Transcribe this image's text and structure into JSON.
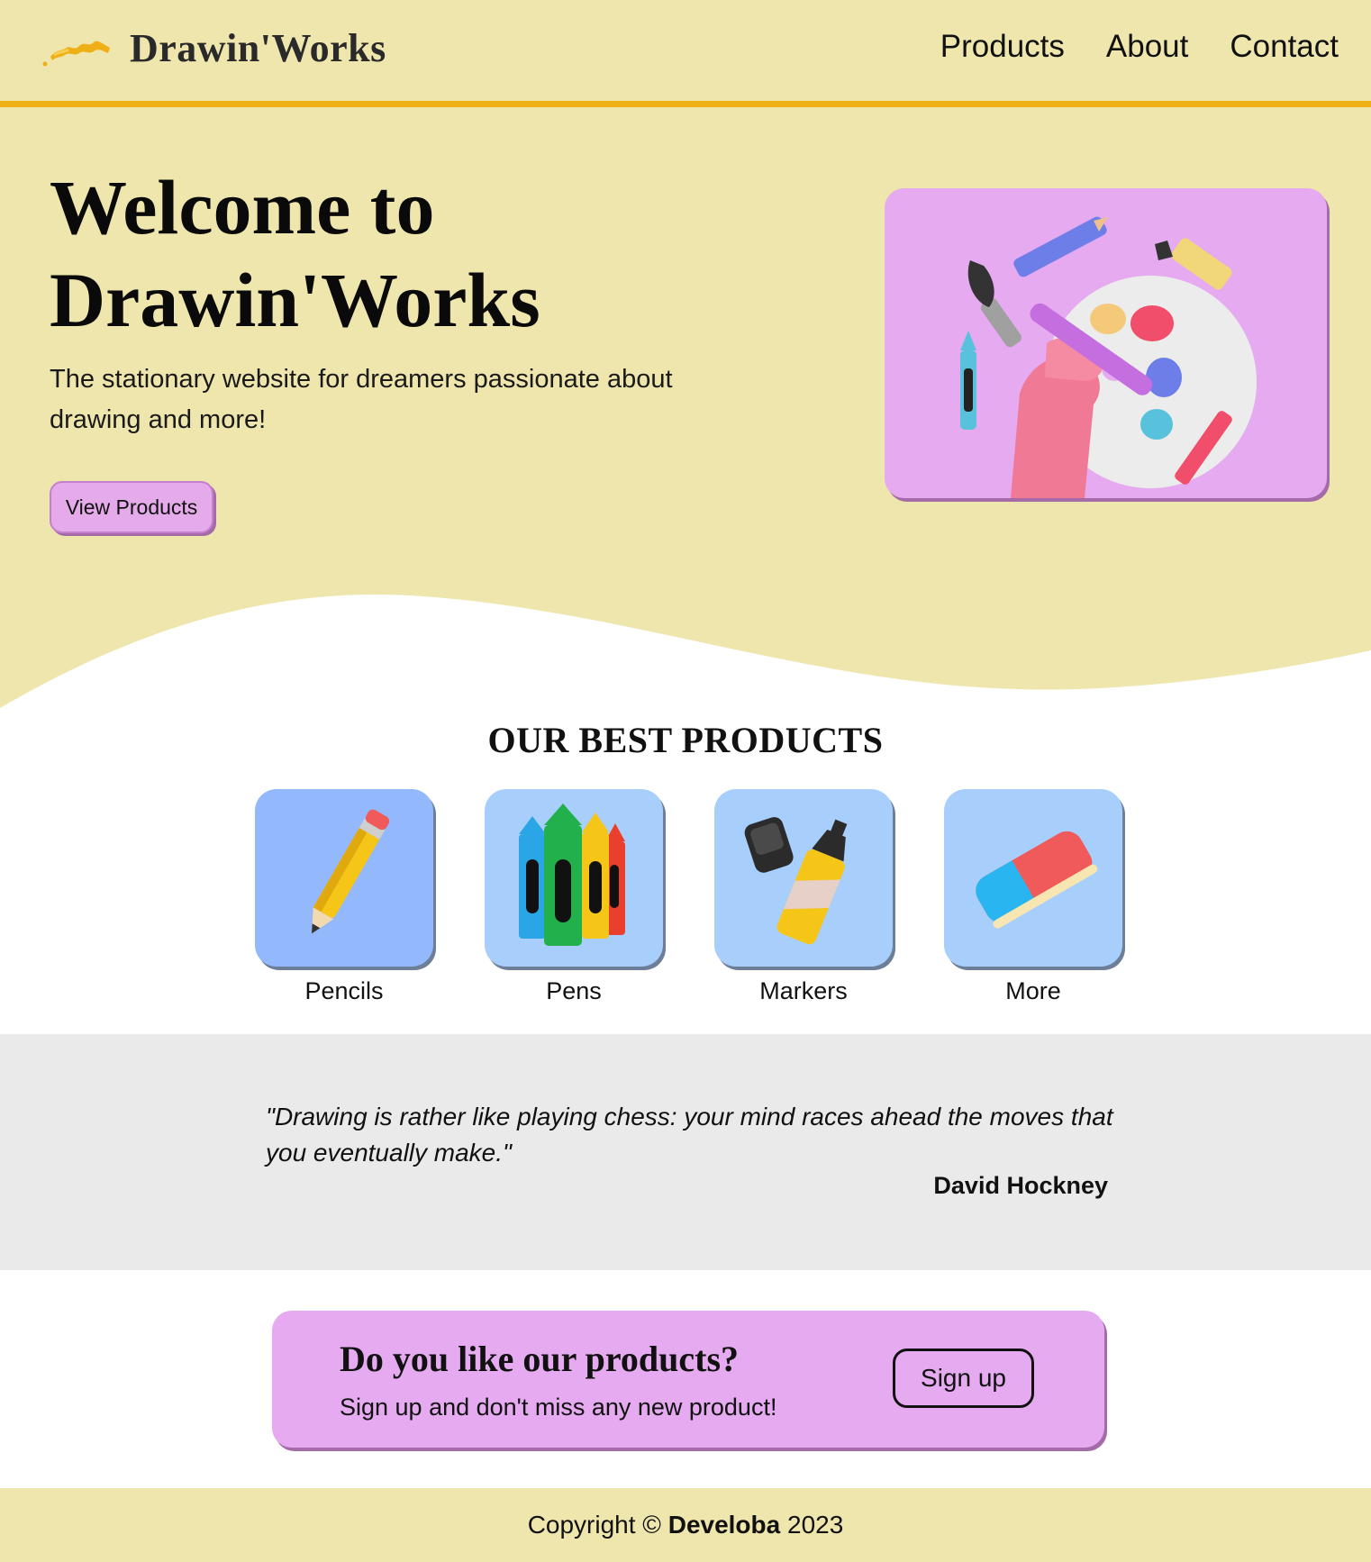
{
  "brand": {
    "name": "Drawin'Works",
    "logo_icon": "paint-stroke-icon",
    "accent": "#efaf16"
  },
  "nav": {
    "items": [
      "Products",
      "About",
      "Contact"
    ]
  },
  "hero": {
    "title_line1": "Welcome to",
    "title_line2": "Drawin'Works",
    "subtitle": "The stationary website for dreamers passionate about drawing and more!",
    "button_label": "View Products",
    "image_icon": "hand-holding-paintbrush-palette-illustration"
  },
  "products": {
    "title": "OUR BEST PRODUCTS",
    "items": [
      {
        "label": "Pencils",
        "icon": "pencil-icon"
      },
      {
        "label": "Pens",
        "icon": "crayons-icon"
      },
      {
        "label": "Markers",
        "icon": "marker-icon"
      },
      {
        "label": "More",
        "icon": "eraser-icon"
      }
    ]
  },
  "quote": {
    "text": "\"Drawing is rather like playing chess: your mind races ahead the moves that you eventually make.\"",
    "author": "David Hockney"
  },
  "cta": {
    "title": "Do you like our products?",
    "subtitle": "Sign up and don't miss any new product!",
    "button_label": "Sign up"
  },
  "footer": {
    "prefix": "Copyright ©",
    "company": "Develoba",
    "year": "2023"
  },
  "colors": {
    "header_bg": "#efe6ae",
    "accent_purple": "#e5aaf0",
    "quote_bg": "#eaeaea",
    "card_blue": "#a8cffc"
  }
}
